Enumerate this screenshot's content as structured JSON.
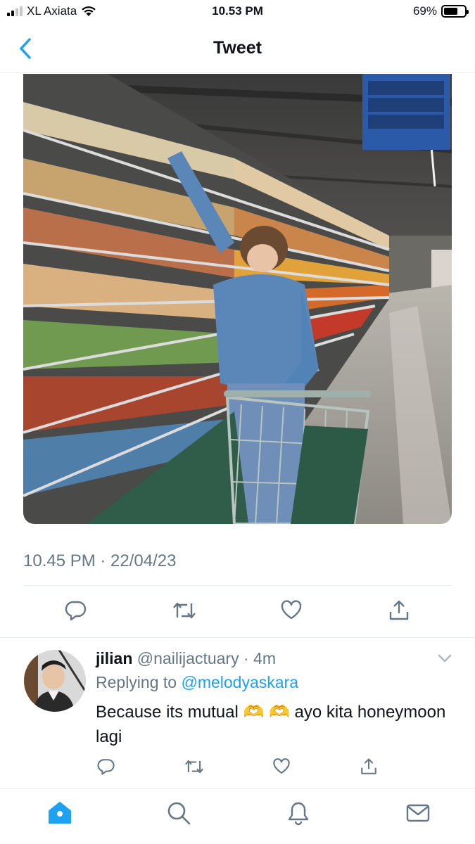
{
  "status_bar": {
    "carrier": "XL Axiata",
    "time": "10.53 PM",
    "battery_text": "69%",
    "battery_level": 0.69
  },
  "header": {
    "title": "Tweet"
  },
  "tweet": {
    "timestamp": "10.45 PM · 22/04/23",
    "photo_icon": "grocery-photo"
  },
  "reply": {
    "name": "jilian",
    "handle": "@nailijactuary",
    "dot": " · ",
    "time": "4m",
    "replying_prefix": "Replying to ",
    "replying_handle": "@melodyaskara",
    "text": "Because its mutual 🫶 🫶  ayo kita honeymoon lagi"
  },
  "colors": {
    "accent": "#1da1f2",
    "secondary_text": "#657786",
    "divider": "#e6ecf0"
  },
  "icons": {
    "actions": [
      "reply-icon",
      "retweet-icon",
      "like-icon",
      "share-icon"
    ],
    "tabs": [
      "home-icon",
      "search-icon",
      "notifications-icon",
      "messages-icon"
    ]
  }
}
